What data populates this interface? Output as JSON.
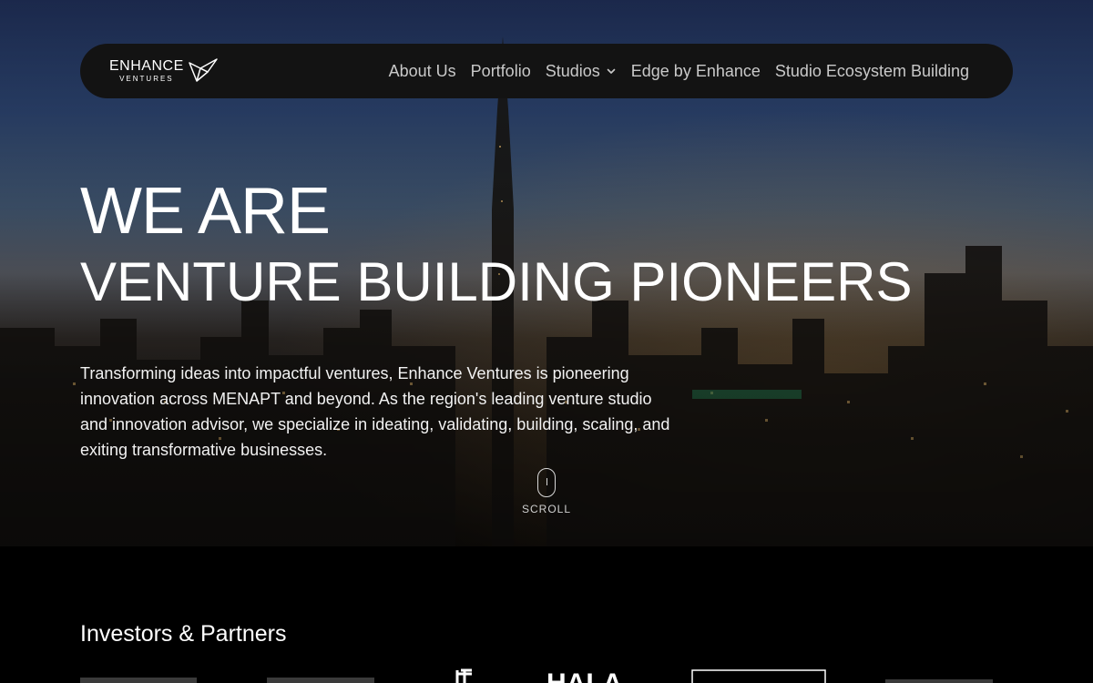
{
  "nav": {
    "logo_main": "ENHANCE",
    "logo_sub": "VENTURES",
    "links": [
      "About Us",
      "Portfolio",
      "Studios",
      "Edge by Enhance",
      "Studio Ecosystem Building"
    ]
  },
  "hero": {
    "headline_1": "WE ARE",
    "headline_2": "VENTURE BUILDING PIONEERS",
    "intro": "Transforming ideas into impactful ventures, Enhance Ventures is pioneering innovation across MENAPT and beyond. As the region's leading venture studio and innovation advisor, we specialize in ideating, validating, building, scaling, and exiting transformative businesses.",
    "scroll_label": "SCROLL"
  },
  "partners": {
    "title": "Investors & Partners",
    "visible_logo_text": [
      "HALA"
    ]
  },
  "colors": {
    "nav_bg": "#131313",
    "nav_link": "#c9c9c9",
    "page_bg": "#000000"
  },
  "icons": [
    "enhance-logo-icon",
    "chevron-down-icon",
    "mouse-scroll-icon"
  ]
}
